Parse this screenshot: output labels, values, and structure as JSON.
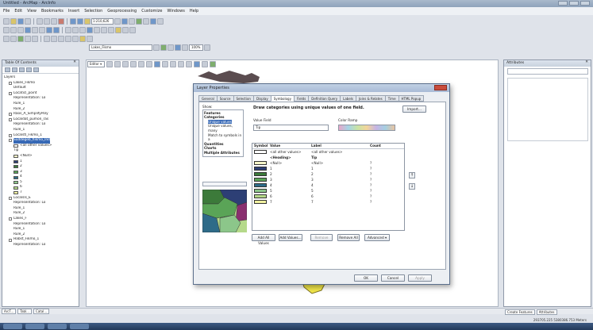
{
  "window": {
    "title": "Untitled - ArcMap - ArcInfo"
  },
  "menu": [
    "File",
    "Edit",
    "View",
    "Bookmarks",
    "Insert",
    "Selection",
    "Geoprocessing",
    "Customize",
    "Windows",
    "Help"
  ],
  "toolbar": {
    "scale": "1:210,626",
    "editor_label": "Editor ▾",
    "layer_dropdown": "Lakes_Fikmo",
    "zoom_combo": "100%"
  },
  "toc": {
    "title": "Table Of Contents",
    "close": "✕",
    "items": [
      {
        "text": "Layers",
        "indent": 0,
        "check": false,
        "selected": false,
        "swatch": ""
      },
      {
        "text": "Lakes_Fikmo",
        "indent": 1,
        "check": true,
        "selected": false,
        "swatch": ""
      },
      {
        "text": "Default",
        "indent": 2,
        "check": false,
        "selected": false,
        "swatch": ""
      },
      {
        "text": "Locaticl_point",
        "indent": 1,
        "check": true,
        "selected": false,
        "swatch": ""
      },
      {
        "text": "Representation: Lo",
        "indent": 2,
        "check": false,
        "selected": false,
        "swatch": ""
      },
      {
        "text": "Rule_1",
        "indent": 2,
        "check": false,
        "selected": false,
        "swatch": ""
      },
      {
        "text": "Rule_2",
        "indent": 2,
        "check": false,
        "selected": false,
        "swatch": ""
      },
      {
        "text": "Raos_A_SimplifyPoly",
        "indent": 1,
        "check": true,
        "selected": false,
        "swatch": ""
      },
      {
        "text": "Localdat_pumon_ras",
        "indent": 1,
        "check": true,
        "selected": false,
        "swatch": ""
      },
      {
        "text": "Representation: Lo",
        "indent": 2,
        "check": false,
        "selected": false,
        "swatch": ""
      },
      {
        "text": "Rule_1",
        "indent": 2,
        "check": false,
        "selected": false,
        "swatch": ""
      },
      {
        "text": "Localstl_Fikmo_1",
        "indent": 1,
        "check": true,
        "selected": false,
        "swatch": ""
      },
      {
        "text": "Suddegeb_flikmo_lnd",
        "indent": 1,
        "check": true,
        "selected": true,
        "swatch": ""
      },
      {
        "text": "<all other values>",
        "indent": 2,
        "check": false,
        "selected": false,
        "swatch": "#ffffff"
      },
      {
        "text": "Tip",
        "indent": 2,
        "check": false,
        "selected": false,
        "swatch": ""
      },
      {
        "text": "<Null>",
        "indent": 2,
        "check": false,
        "selected": false,
        "swatch": "#f4f4c8"
      },
      {
        "text": "1",
        "indent": 2,
        "check": false,
        "selected": false,
        "swatch": "#2d3f75"
      },
      {
        "text": "2",
        "indent": 2,
        "check": false,
        "selected": false,
        "swatch": "#3c7a3a"
      },
      {
        "text": "3",
        "indent": 2,
        "check": false,
        "selected": false,
        "swatch": "#5aa457"
      },
      {
        "text": "4",
        "indent": 2,
        "check": false,
        "selected": false,
        "swatch": "#2e6b88"
      },
      {
        "text": "5",
        "indent": 2,
        "check": false,
        "selected": false,
        "swatch": "#8cc68a"
      },
      {
        "text": "6",
        "indent": 2,
        "check": false,
        "selected": false,
        "swatch": "#b5d98a"
      },
      {
        "text": "7",
        "indent": 2,
        "check": false,
        "selected": false,
        "swatch": "#f0f0a0"
      },
      {
        "text": "Localsls_E",
        "indent": 1,
        "check": true,
        "selected": false,
        "swatch": ""
      },
      {
        "text": "Representation: Lo",
        "indent": 2,
        "check": false,
        "selected": false,
        "swatch": ""
      },
      {
        "text": "Rule_1",
        "indent": 2,
        "check": false,
        "selected": false,
        "swatch": ""
      },
      {
        "text": "Rule_2",
        "indent": 2,
        "check": false,
        "selected": false,
        "swatch": ""
      },
      {
        "text": "Lakes_F",
        "indent": 1,
        "check": true,
        "selected": false,
        "swatch": ""
      },
      {
        "text": "Representation: Lo",
        "indent": 2,
        "check": false,
        "selected": false,
        "swatch": ""
      },
      {
        "text": "Rule_1",
        "indent": 2,
        "check": false,
        "selected": false,
        "swatch": ""
      },
      {
        "text": "Rule_2",
        "indent": 2,
        "check": false,
        "selected": false,
        "swatch": ""
      },
      {
        "text": "Habst_Fikmo_1",
        "indent": 1,
        "check": true,
        "selected": false,
        "swatch": ""
      },
      {
        "text": "Representation: Lo",
        "indent": 2,
        "check": false,
        "selected": false,
        "swatch": ""
      }
    ]
  },
  "toc_tabs": [
    "ArcT...",
    "Tabl...",
    "Catal..."
  ],
  "dialog": {
    "title": "Layer Properties",
    "tabs": [
      "General",
      "Source",
      "Selection",
      "Display",
      "Symbology",
      "Fields",
      "Definition Query",
      "Labels",
      "Joins & Relates",
      "Time",
      "HTML Popup"
    ],
    "active_tab": "Symbology",
    "show_label": "Show:",
    "show_items": [
      {
        "text": "Features",
        "bold": true,
        "sub": false,
        "hl": false
      },
      {
        "text": "Categories",
        "bold": true,
        "sub": false,
        "hl": false
      },
      {
        "text": "Unique values",
        "bold": false,
        "sub": true,
        "hl": true
      },
      {
        "text": "Unique values, many",
        "bold": false,
        "sub": true,
        "hl": false
      },
      {
        "text": "Match to symbols in a",
        "bold": false,
        "sub": true,
        "hl": false
      },
      {
        "text": "Quantities",
        "bold": true,
        "sub": false,
        "hl": false
      },
      {
        "text": "Charts",
        "bold": true,
        "sub": false,
        "hl": false
      },
      {
        "text": "Multiple Attributes",
        "bold": true,
        "sub": false,
        "hl": false
      }
    ],
    "heading": "Draw categories using unique values of one field.",
    "import_btn": "Import...",
    "value_field_label": "Value Field",
    "value_field": "Tip",
    "color_ramp_label": "Color Ramp",
    "columns": [
      "Symbol",
      "Value",
      "Label",
      "Count"
    ],
    "rows": [
      {
        "value": "<all other values>",
        "label": "<all other values>",
        "count": "",
        "color": "#ffffff",
        "check": true
      },
      {
        "value": "<Heading>",
        "label": "Tip",
        "count": "",
        "color": "",
        "check": false
      },
      {
        "value": "<Null>",
        "label": "<Null>",
        "count": "?",
        "color": "#f4f4c8",
        "check": false
      },
      {
        "value": "1",
        "label": "1",
        "count": "?",
        "color": "#2d3f75",
        "check": false
      },
      {
        "value": "2",
        "label": "2",
        "count": "?",
        "color": "#3c7a3a",
        "check": false
      },
      {
        "value": "3",
        "label": "3",
        "count": "?",
        "color": "#5aa457",
        "check": false
      },
      {
        "value": "4",
        "label": "4",
        "count": "?",
        "color": "#2e6b88",
        "check": false
      },
      {
        "value": "5",
        "label": "5",
        "count": "?",
        "color": "#8cc68a",
        "check": false
      },
      {
        "value": "6",
        "label": "6",
        "count": "?",
        "color": "#b5d98a",
        "check": false
      },
      {
        "value": "7",
        "label": "7",
        "count": "?",
        "color": "#f0f0a0",
        "check": false
      }
    ],
    "buttons": {
      "add_all": "Add All Values",
      "add_values": "Add Values...",
      "remove": "Remove",
      "remove_all": "Remove All",
      "advanced": "Advanced ▾",
      "ok": "OK",
      "cancel": "Cancel",
      "apply": "Apply"
    }
  },
  "attributes": {
    "title": "Attributes",
    "close": "✕"
  },
  "attr_tabs": [
    "Create Features",
    "Attributes"
  ],
  "coords": "293705.225  5380386.753 Meters"
}
